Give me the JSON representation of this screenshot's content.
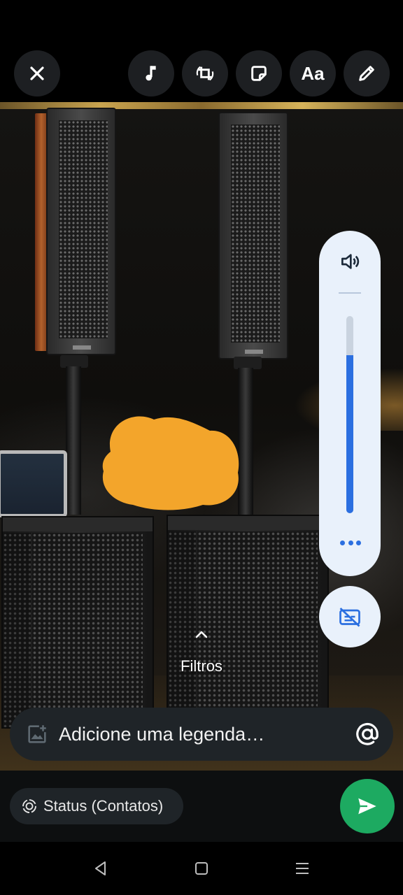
{
  "toolbar": {
    "close_icon": "close-icon",
    "music_icon": "music-note-icon",
    "crop_icon": "crop-rotate-icon",
    "sticker_icon": "sticker-icon",
    "text_label": "Aa",
    "draw_icon": "pencil-icon"
  },
  "volume": {
    "speaker_icon": "volume-icon",
    "level": 0.8,
    "more_icon": "more-dots-icon",
    "captions_icon": "captions-off-icon",
    "accent_color": "#2b6fe0"
  },
  "filters": {
    "label": "Filtros",
    "chevron_icon": "chevron-up-icon"
  },
  "caption": {
    "placeholder": "Adicione uma legenda…",
    "add_media_icon": "add-media-icon",
    "mention_icon": "at-sign-icon"
  },
  "status": {
    "label": "Status (Contatos)",
    "icon": "status-icon"
  },
  "send": {
    "icon": "send-icon",
    "color": "#1daa61"
  },
  "navbar": {
    "back_icon": "nav-back-icon",
    "home_icon": "nav-home-icon",
    "recents_icon": "nav-recents-icon"
  }
}
